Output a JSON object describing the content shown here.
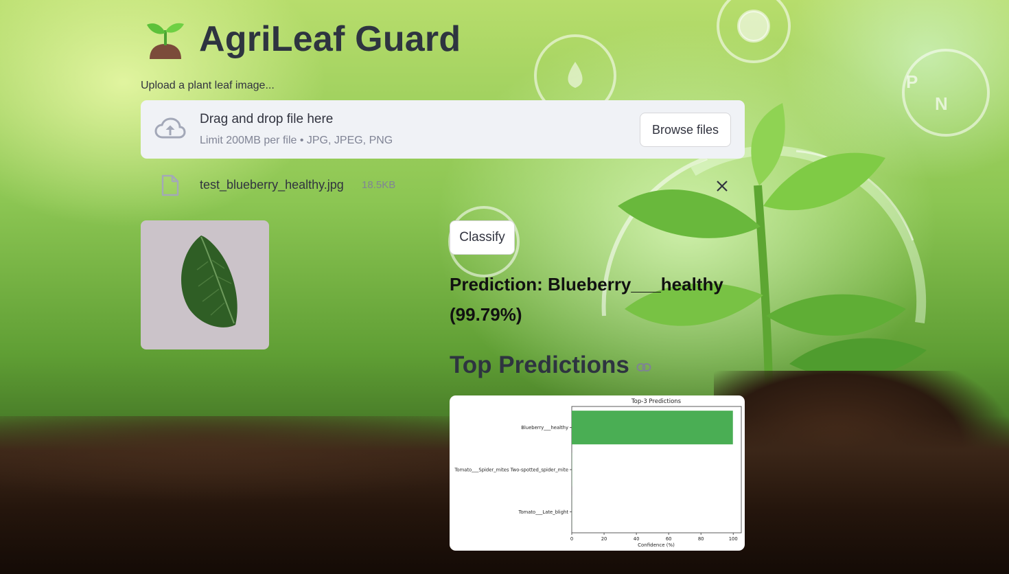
{
  "app": {
    "title": "AgriLeaf Guard",
    "logo_icon": "seedling-icon"
  },
  "uploader": {
    "label": "Upload a plant leaf image...",
    "drop_title": "Drag and drop file here",
    "drop_limit": "Limit 200MB per file • JPG, JPEG, PNG",
    "browse_label": "Browse files"
  },
  "file": {
    "name": "test_blueberry_healthy.jpg",
    "size": "18.5KB"
  },
  "actions": {
    "classify_label": "Classify"
  },
  "result": {
    "prediction_text": "Prediction: Blueberry___healthy (99.79%)"
  },
  "top_predictions": {
    "heading": "Top Predictions"
  },
  "colors": {
    "bar": "#4aae54",
    "title": "#2e3440"
  },
  "chart_data": {
    "type": "bar",
    "orientation": "horizontal",
    "title": "Top-3 Predictions",
    "xlabel": "Confidence (%)",
    "ylabel": "",
    "categories": [
      "Blueberry___healthy",
      "Tomato___Spider_mites Two-spotted_spider_mite",
      "Tomato___Late_blight"
    ],
    "values": [
      99.79,
      0.1,
      0.05
    ],
    "xlim": [
      0,
      105
    ],
    "xticks": [
      0,
      20,
      40,
      60,
      80,
      100
    ],
    "grid": false
  }
}
